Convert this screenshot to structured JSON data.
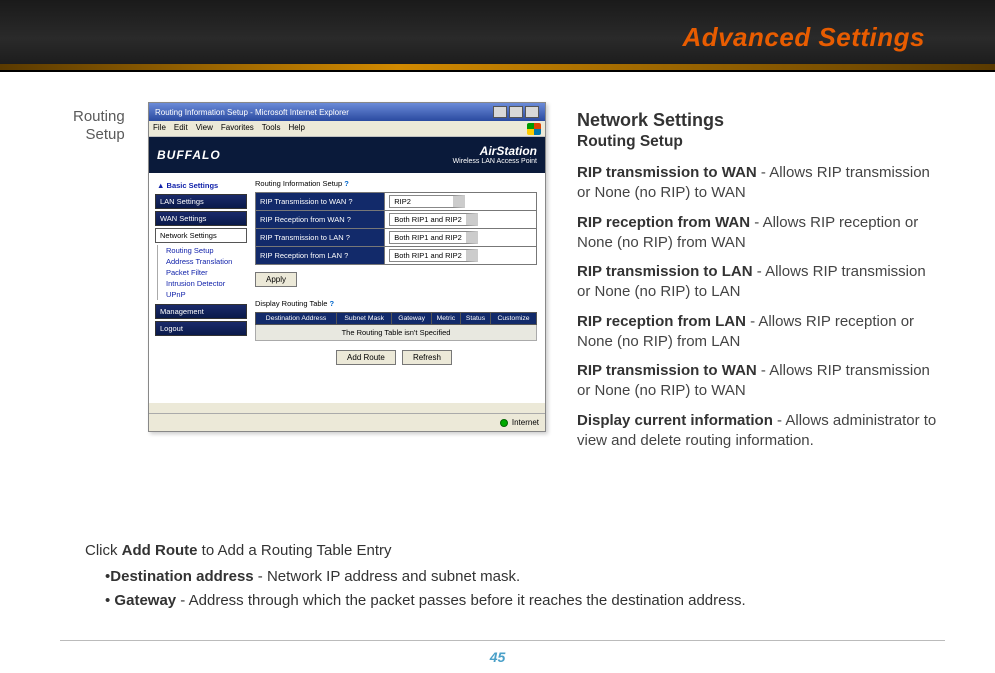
{
  "page": {
    "header": "Advanced Settings",
    "number": "45"
  },
  "caption": {
    "l1": "Routing",
    "l2": "Setup"
  },
  "right": {
    "title": "Network Settings",
    "subtitle": "Routing Setup",
    "items": [
      {
        "b": "RIP transmission to WAN",
        "t": " - Allows RIP transmission or None (no RIP) to WAN"
      },
      {
        "b": "RIP reception from WAN",
        "t": " - Allows RIP reception or None (no RIP) from WAN"
      },
      {
        "b": "RIP transmission to LAN",
        "t": " - Allows RIP transmission or None (no RIP) to LAN"
      },
      {
        "b": "RIP reception from LAN",
        "t": " - Allows RIP reception or None (no RIP) from LAN"
      },
      {
        "b": "RIP transmission to WAN",
        "t": " - Allows RIP transmission or None (no RIP) to WAN"
      },
      {
        "b": "Display current information",
        "t": " - Allows administrator to view and delete routing information."
      }
    ]
  },
  "bottom": {
    "l1a": "Click ",
    "l1b": "Add Route",
    "l1c": " to Add a Routing Table Entry",
    "s1b": "Destination address",
    "s1t": " - Network IP address and subnet mask.",
    "s2b": " Gateway",
    "s2t": " - Address through which the packet passes before it reaches the destination address."
  },
  "shot": {
    "title": "Routing Information Setup - Microsoft Internet Explorer",
    "menu": [
      "File",
      "Edit",
      "View",
      "Favorites",
      "Tools",
      "Help"
    ],
    "brand": "BUFFALO",
    "air_big": "AirStation",
    "air_sub": "Wireless LAN Access Point",
    "side_head": "Basic Settings",
    "side_sections_top": [
      "LAN Settings",
      "WAN Settings"
    ],
    "side_sections_active": "Network Settings",
    "side_subs": [
      "Routing Setup",
      "Address Translation",
      "Packet Filter",
      "Intrusion Detector",
      "UPnP"
    ],
    "side_sections_bottom": [
      "Management",
      "Logout"
    ],
    "main_head": "Routing Information Setup",
    "q": "?",
    "rows": [
      {
        "label": "RIP Transmission to WAN",
        "value": "RIP2"
      },
      {
        "label": "RIP Reception from WAN",
        "value": "Both RIP1 and RIP2"
      },
      {
        "label": "RIP Transmission to LAN",
        "value": "Both RIP1 and RIP2"
      },
      {
        "label": "RIP Reception from LAN",
        "value": "Both RIP1 and RIP2"
      }
    ],
    "apply": "Apply",
    "disp_head": "Display Routing Table",
    "cols": [
      "Destination Address",
      "Subnet Mask",
      "Gateway",
      "Metric",
      "Status",
      "Customize"
    ],
    "empty": "The Routing Table isn't Specified",
    "add": "Add Route",
    "refresh": "Refresh",
    "status": "Internet"
  }
}
